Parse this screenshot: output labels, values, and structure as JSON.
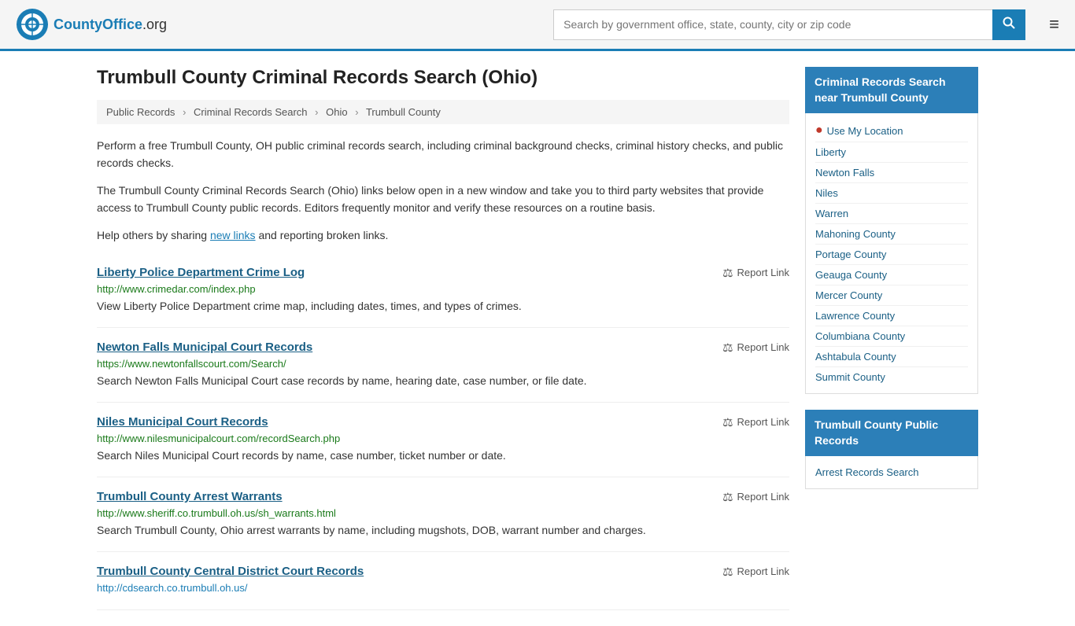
{
  "header": {
    "logo_text": "CountyOffice",
    "logo_org": ".org",
    "search_placeholder": "Search by government office, state, county, city or zip code",
    "search_btn_label": "🔍",
    "menu_btn_label": "≡"
  },
  "page": {
    "title": "Trumbull County Criminal Records Search (Ohio)",
    "breadcrumb": [
      "Public Records",
      "Criminal Records Search",
      "Ohio",
      "Trumbull County"
    ]
  },
  "intro": {
    "p1": "Perform a free Trumbull County, OH public criminal records search, including criminal background checks, criminal history checks, and public records checks.",
    "p2": "The Trumbull County Criminal Records Search (Ohio) links below open in a new window and take you to third party websites that provide access to Trumbull County public records. Editors frequently monitor and verify these resources on a routine basis.",
    "p3_start": "Help others by sharing ",
    "p3_link": "new links",
    "p3_end": " and reporting broken links."
  },
  "results": [
    {
      "title": "Liberty Police Department Crime Log",
      "url": "http://www.crimedar.com/index.php",
      "url_color": "green",
      "desc": "View Liberty Police Department crime map, including dates, times, and types of crimes.",
      "report_label": "Report Link"
    },
    {
      "title": "Newton Falls Municipal Court Records",
      "url": "https://www.newtonfallscourt.com/Search/",
      "url_color": "green",
      "desc": "Search Newton Falls Municipal Court case records by name, hearing date, case number, or file date.",
      "report_label": "Report Link"
    },
    {
      "title": "Niles Municipal Court Records",
      "url": "http://www.nilesmunicipalcourt.com/recordSearch.php",
      "url_color": "green",
      "desc": "Search Niles Municipal Court records by name, case number, ticket number or date.",
      "report_label": "Report Link"
    },
    {
      "title": "Trumbull County Arrest Warrants",
      "url": "http://www.sheriff.co.trumbull.oh.us/sh_warrants.html",
      "url_color": "green",
      "desc": "Search Trumbull County, Ohio arrest warrants by name, including mugshots, DOB, warrant number and charges.",
      "report_label": "Report Link"
    },
    {
      "title": "Trumbull County Central District Court Records",
      "url": "http://cdsearch.co.trumbull.oh.us/",
      "url_color": "blue",
      "desc": "",
      "report_label": "Report Link"
    }
  ],
  "sidebar": {
    "section1_header": "Criminal Records Search near Trumbull County",
    "use_location": "Use My Location",
    "links": [
      "Liberty",
      "Newton Falls",
      "Niles",
      "Warren",
      "Mahoning County",
      "Portage County",
      "Geauga County",
      "Mercer County",
      "Lawrence County",
      "Columbiana County",
      "Ashtabula County",
      "Summit County"
    ],
    "section2_header": "Trumbull County Public Records",
    "section2_links": [
      "Arrest Records Search"
    ]
  }
}
